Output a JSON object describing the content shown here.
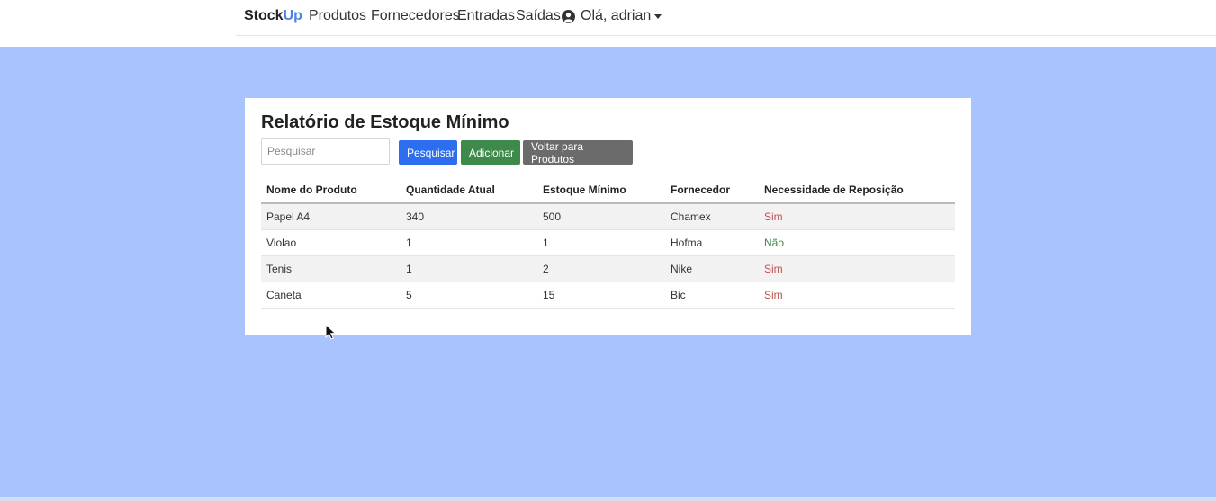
{
  "nav": {
    "brand_stock": "Stock",
    "brand_up": "Up",
    "links": [
      "Produtos",
      "Fornecedores",
      "Entradas",
      "Saídas"
    ],
    "user_greeting": "Olá, adrian"
  },
  "card": {
    "title": "Relatório de Estoque Mínimo",
    "search_placeholder": "Pesquisar",
    "search_value": "",
    "buttons": {
      "search": "Pesquisar",
      "add": "Adicionar",
      "back": "Voltar para Produtos"
    }
  },
  "table": {
    "headers": [
      "Nome do Produto",
      "Quantidade Atual",
      "Estoque Mínimo",
      "Fornecedor",
      "Necessidade de Reposição"
    ],
    "rows": [
      [
        "Papel A4",
        "340",
        "500",
        "Chamex",
        "Sim"
      ],
      [
        "Violao",
        "1",
        "1",
        "Hofma",
        "Não"
      ],
      [
        "Tenis",
        "1",
        "2",
        "Nike",
        "Sim"
      ],
      [
        "Caneta",
        "5",
        "15",
        "Bic",
        "Sim"
      ]
    ]
  },
  "colors": {
    "page_background": "#a9c3ff",
    "brand_accent": "#4a84e8",
    "primary_button": "#2d6ef0",
    "success_button": "#3d8a4a",
    "secondary_button": "#6b6b6b",
    "status_yes": "#c0504d",
    "status_no": "#3d8a4a"
  },
  "icons": {
    "user": "user-circle-icon",
    "dropdown": "caret-down-icon",
    "cursor": "mouse-pointer-icon"
  }
}
